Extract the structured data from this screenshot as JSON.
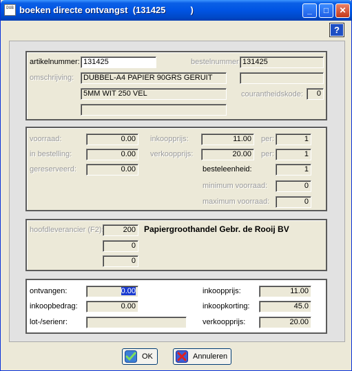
{
  "window": {
    "title": "boeken directe ontvangst  (131425          )",
    "icon_text": "DUB"
  },
  "titlebar_buttons": {
    "minimize": "_",
    "maximize": "□",
    "close": "✕",
    "help": "?"
  },
  "article": {
    "artikelnummer_label": "artikelnummer:",
    "artikelnummer": "131425",
    "bestelnummer_label": "bestelnummer:",
    "bestelnummer": "131425",
    "omschrijving_label": "omschrijving:",
    "omschrijving_1": "DUBBEL-A4 PAPIER 90GRS GERUIT",
    "omschrijving_2": "5MM WIT 250 VEL",
    "omschrijving_3": "",
    "extra_field": "",
    "courantheidskode_label": "courantheidskode:",
    "courantheidskode": "0"
  },
  "stock": {
    "voorraad_label": "voorraad:",
    "voorraad": "0.00",
    "in_bestelling_label": "in bestelling:",
    "in_bestelling": "0.00",
    "gereserveerd_label": "gereserveerd:",
    "gereserveerd": "0.00",
    "inkoopprijs_label": "inkoopprijs:",
    "inkoopprijs": "11.00",
    "verkoopprijs_label": "verkoopprijs:",
    "verkoopprijs": "20.00",
    "per_label_1": "per:",
    "per_1": "1",
    "per_label_2": "per:",
    "per_2": "1",
    "besteleenheid_label": "besteleenheid:",
    "besteleenheid": "1",
    "minimum_voorraad_label": "minimum voorraad:",
    "minimum_voorraad": "0",
    "maximum_voorraad_label": "maximum voorraad:",
    "maximum_voorraad": "0"
  },
  "supplier": {
    "hoofdleverancier_label": "hoofdleverancier (F2):",
    "hoofdleverancier": "200",
    "supplier_name": "Papiergroothandel Gebr. de Rooij BV",
    "lev_2": "0",
    "lev_3": "0"
  },
  "receipt": {
    "ontvangen_label": "ontvangen:",
    "ontvangen": "0.00",
    "inkoopbedrag_label": "inkoopbedrag:",
    "inkoopbedrag": "0.00",
    "lot_label": "lot-/serienr:",
    "lot": "",
    "inkoopprijs_label": "inkoopprijs:",
    "inkoopprijs": "11.00",
    "inkoopkorting_label": "inkoopkorting:",
    "inkoopkorting": "45.0",
    "verkoopprijs_label": "verkoopprijs:",
    "verkoopprijs": "20.00"
  },
  "buttons": {
    "ok": "OK",
    "cancel": "Annuleren"
  }
}
